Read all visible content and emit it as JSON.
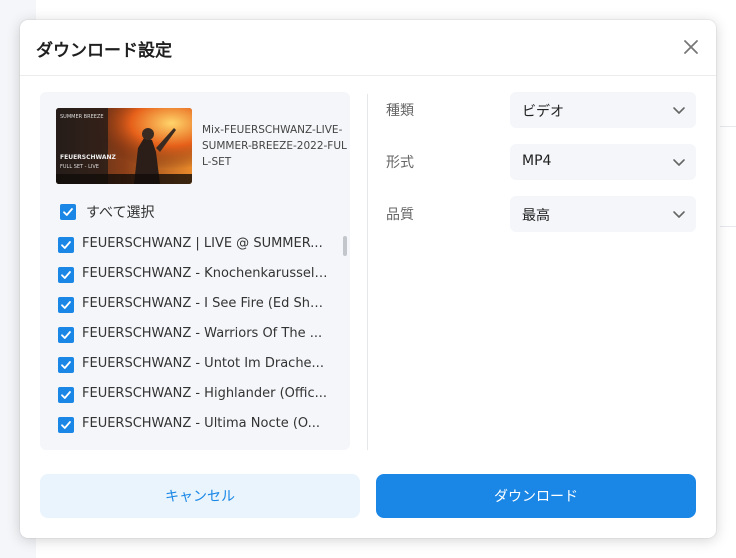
{
  "dialog": {
    "title": "ダウンロード設定",
    "close_icon": "close-icon"
  },
  "media": {
    "title": "Mix-FEUERSCHWANZ-LIVE-SUMMER-BREEZE-2022-FULL-SET",
    "thumbnail_text_top": "SUMMER BREEZE",
    "thumbnail_text_main": "FEUERSCHWANZ",
    "thumbnail_text_sub": "FULL SET - LIVE"
  },
  "select_all": {
    "label": "すべて選択",
    "checked": true
  },
  "items": [
    {
      "label": "FEUERSCHWANZ | LIVE @ SUMMER...",
      "checked": true
    },
    {
      "label": "FEUERSCHWANZ - Knochenkarussell...",
      "checked": true
    },
    {
      "label": "FEUERSCHWANZ - I See Fire (Ed She...",
      "checked": true
    },
    {
      "label": "FEUERSCHWANZ - Warriors Of The ...",
      "checked": true
    },
    {
      "label": "FEUERSCHWANZ - Untot Im Drache...",
      "checked": true
    },
    {
      "label": "FEUERSCHWANZ - Highlander (Offic...",
      "checked": true
    },
    {
      "label": "FEUERSCHWANZ - Ultima Nocte (O...",
      "checked": true
    }
  ],
  "settings": {
    "type": {
      "label": "種類",
      "value": "ビデオ"
    },
    "format": {
      "label": "形式",
      "value": "MP4"
    },
    "quality": {
      "label": "品質",
      "value": "最高"
    }
  },
  "buttons": {
    "cancel": "キャンセル",
    "download": "ダウンロード"
  },
  "colors": {
    "accent": "#1a87e6",
    "cancel_bg": "#e9f4fc",
    "panel_bg": "#f4f6f9"
  }
}
